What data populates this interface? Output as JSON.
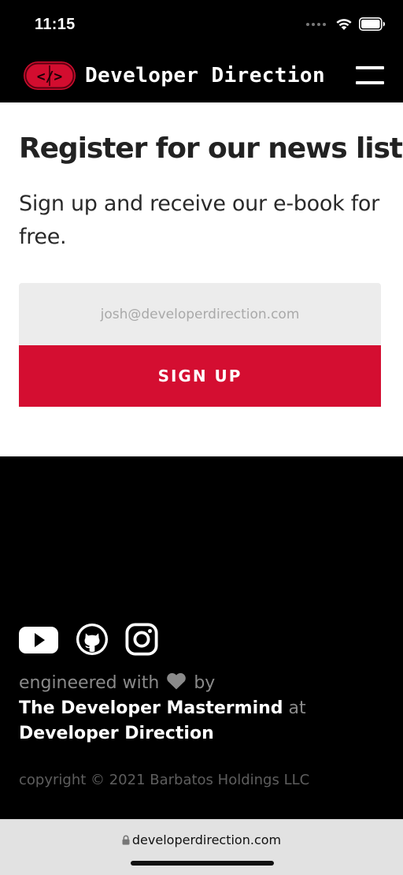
{
  "status_bar": {
    "time": "11:15",
    "icons": [
      "cellular-dots-icon",
      "wifi-icon",
      "battery-icon"
    ]
  },
  "header": {
    "logo_text": "</>",
    "brand_name": "Developer Direction",
    "menu_icon": "hamburger-menu-icon",
    "brand_color": "#d20d2f"
  },
  "signup": {
    "headline": "Register for our news list.",
    "subtext": "Sign up and receive our e-book for free.",
    "email_placeholder": "josh@developerdirection.com",
    "email_value": "",
    "button_label": "SIGN UP",
    "button_color": "#d40e31"
  },
  "footer": {
    "social_icons": [
      "youtube-icon",
      "github-icon",
      "instagram-icon"
    ],
    "credit_prefix": "engineered with",
    "credit_by": "by",
    "credit_name": "The Developer Mastermind",
    "credit_at": "at",
    "credit_company": "Developer Direction",
    "copyright": "copyright © 2021 Barbatos Holdings LLC"
  },
  "browser": {
    "url": "developerdirection.com"
  }
}
